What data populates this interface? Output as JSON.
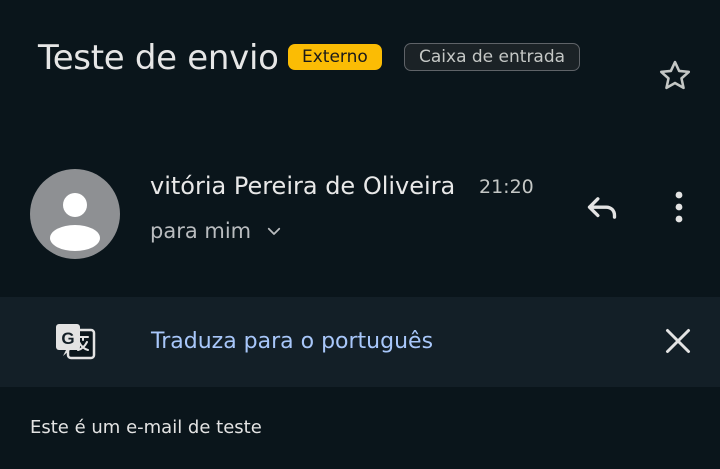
{
  "email": {
    "subject": "Teste de envio",
    "labels": [
      {
        "text": "Externo",
        "color": "#fbbc04"
      },
      {
        "text": "Caixa de entrada"
      }
    ],
    "sender_name": "vitória Pereira de Oliveira",
    "time": "21:20",
    "recipient": "para mim",
    "body": "Este é um e-mail de teste"
  },
  "translate": {
    "link_text": "Traduza para o português"
  },
  "icons": {
    "star": "star-outline-icon",
    "reply": "reply-icon",
    "more": "more-vert-icon",
    "translate": "translate-icon",
    "close": "close-icon",
    "expand": "chevron-down-icon",
    "avatar": "person-icon"
  },
  "colors": {
    "background": "#0a151b",
    "translate_bar": "#131f27",
    "link": "#a8c7fa",
    "external_label": "#fbbc04"
  }
}
